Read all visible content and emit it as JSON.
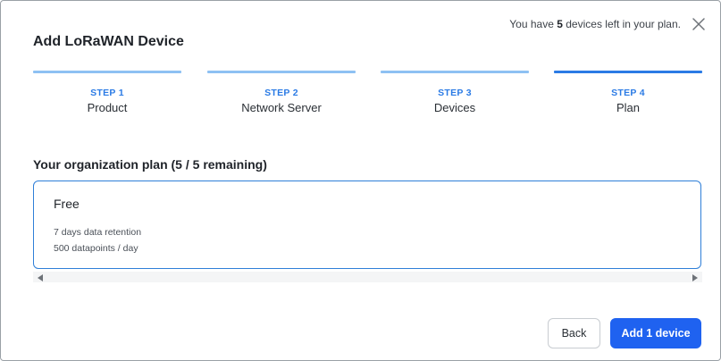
{
  "modal": {
    "title": "Add LoRaWAN Device",
    "devices_left": {
      "prefix": "You have ",
      "count": "5",
      "suffix": " devices left in your plan."
    },
    "close_icon": "close-icon"
  },
  "steps": [
    {
      "number": "STEP 1",
      "name": "Product",
      "state": "complete"
    },
    {
      "number": "STEP 2",
      "name": "Network Server",
      "state": "complete"
    },
    {
      "number": "STEP 3",
      "name": "Devices",
      "state": "complete"
    },
    {
      "number": "STEP 4",
      "name": "Plan",
      "state": "current"
    }
  ],
  "organization": {
    "title": "Your organization plan (5 / 5 remaining)",
    "plan": {
      "name": "Free",
      "features": [
        "7 days data retention",
        "500 datapoints / day"
      ],
      "selected": true
    }
  },
  "footer": {
    "back_label": "Back",
    "add_label": "Add 1 device"
  },
  "colors": {
    "accent": "#2b7be5",
    "accent_light": "#8ec1f3",
    "primary_button": "#1f62f0",
    "text": "#1f2329"
  }
}
